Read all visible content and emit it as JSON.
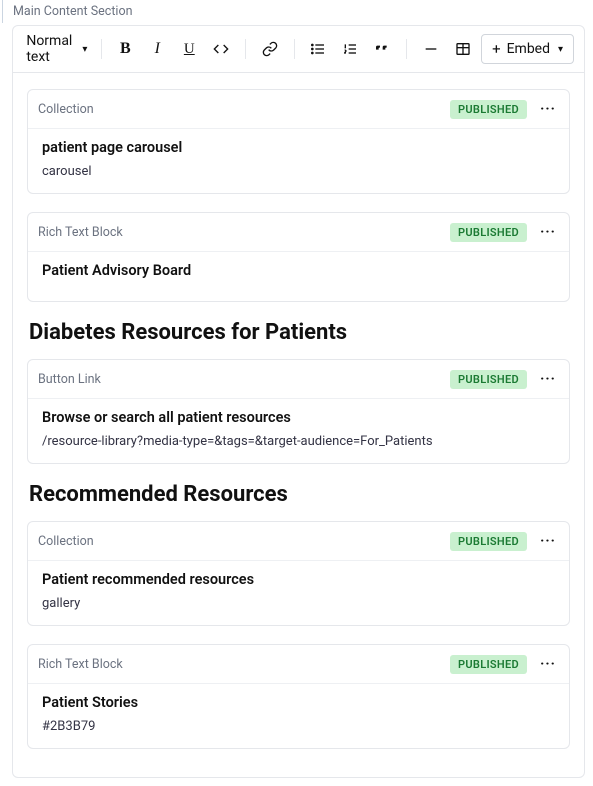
{
  "sectionLabel": "Main Content Section",
  "toolbar": {
    "textStyle": "Normal text",
    "embedLabel": "Embed"
  },
  "blocks": [
    {
      "card": true,
      "type": "Collection",
      "status": "PUBLISHED",
      "title": "patient page carousel",
      "sub": "carousel"
    },
    {
      "card": true,
      "type": "Rich Text Block",
      "status": "PUBLISHED",
      "title": "Patient Advisory Board",
      "sub": null
    },
    {
      "card": false,
      "heading": "Diabetes Resources for Patients"
    },
    {
      "card": true,
      "type": "Button Link",
      "status": "PUBLISHED",
      "title": "Browse or search all patient resources",
      "sub": "/resource-library?media-type=&tags=&target-audience=For_Patients"
    },
    {
      "card": false,
      "heading": "Recommended Resources"
    },
    {
      "card": true,
      "type": "Collection",
      "status": "PUBLISHED",
      "title": "Patient recommended resources",
      "sub": "gallery"
    },
    {
      "card": true,
      "type": "Rich Text Block",
      "status": "PUBLISHED",
      "title": "Patient Stories",
      "sub": "#2B3B79"
    }
  ]
}
